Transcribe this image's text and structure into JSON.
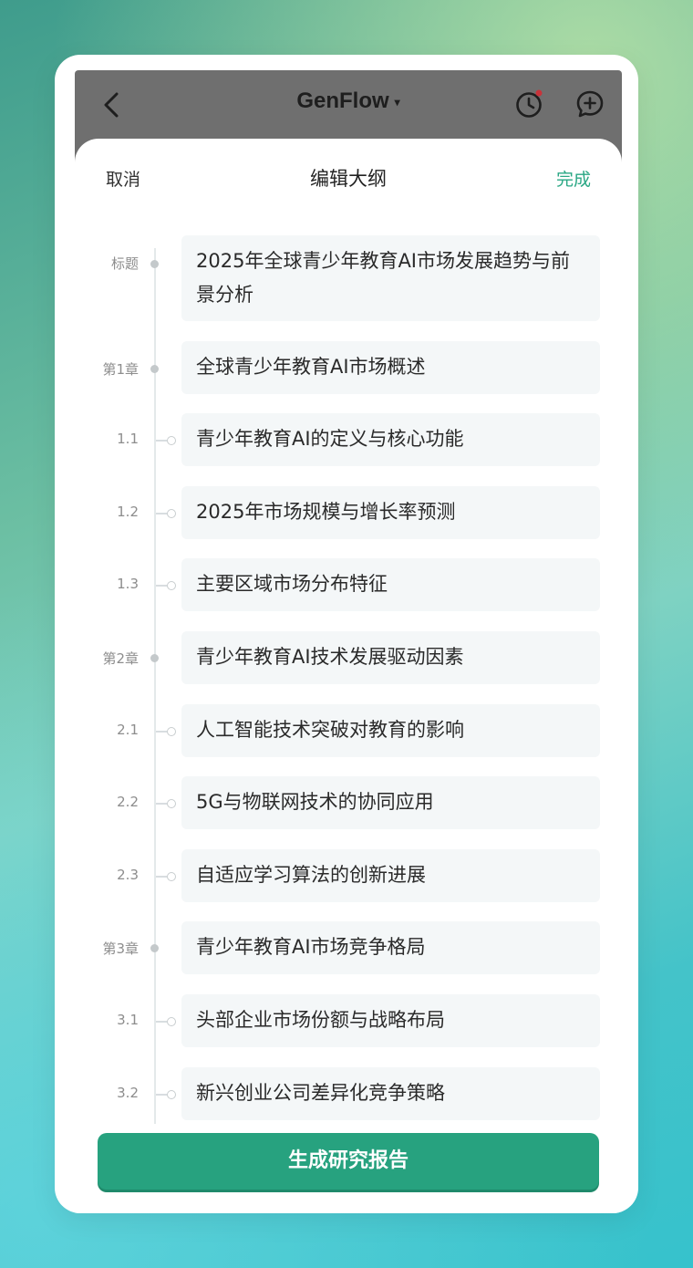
{
  "app_bar": {
    "title": "GenFlow",
    "title_caret": "▾",
    "notification_color": "#c8333a"
  },
  "sheet": {
    "cancel_label": "取消",
    "title": "编辑大纲",
    "done_label": "完成",
    "done_color": "#2aa784"
  },
  "outline": [
    {
      "label": "标题",
      "level": "title",
      "text": "2025年全球青少年教育AI市场发展趋势与前景分析"
    },
    {
      "label": "第1章",
      "level": "chapter",
      "text": "全球青少年教育AI市场概述"
    },
    {
      "label": "1.1",
      "level": "section",
      "text": "青少年教育AI的定义与核心功能"
    },
    {
      "label": "1.2",
      "level": "section",
      "text": "2025年市场规模与增长率预测"
    },
    {
      "label": "1.3",
      "level": "section",
      "text": "主要区域市场分布特征"
    },
    {
      "label": "第2章",
      "level": "chapter",
      "text": "青少年教育AI技术发展驱动因素"
    },
    {
      "label": "2.1",
      "level": "section",
      "text": "人工智能技术突破对教育的影响"
    },
    {
      "label": "2.2",
      "level": "section",
      "text": "5G与物联网技术的协同应用"
    },
    {
      "label": "2.3",
      "level": "section",
      "text": "自适应学习算法的创新进展"
    },
    {
      "label": "第3章",
      "level": "chapter",
      "text": "青少年教育AI市场竞争格局"
    },
    {
      "label": "3.1",
      "level": "section",
      "text": "头部企业市场份额与战略布局"
    },
    {
      "label": "3.2",
      "level": "section",
      "text": "新兴创业公司差异化竞争策略"
    }
  ],
  "generate_button": {
    "label": "生成研究报告",
    "color": "#27a27f"
  }
}
